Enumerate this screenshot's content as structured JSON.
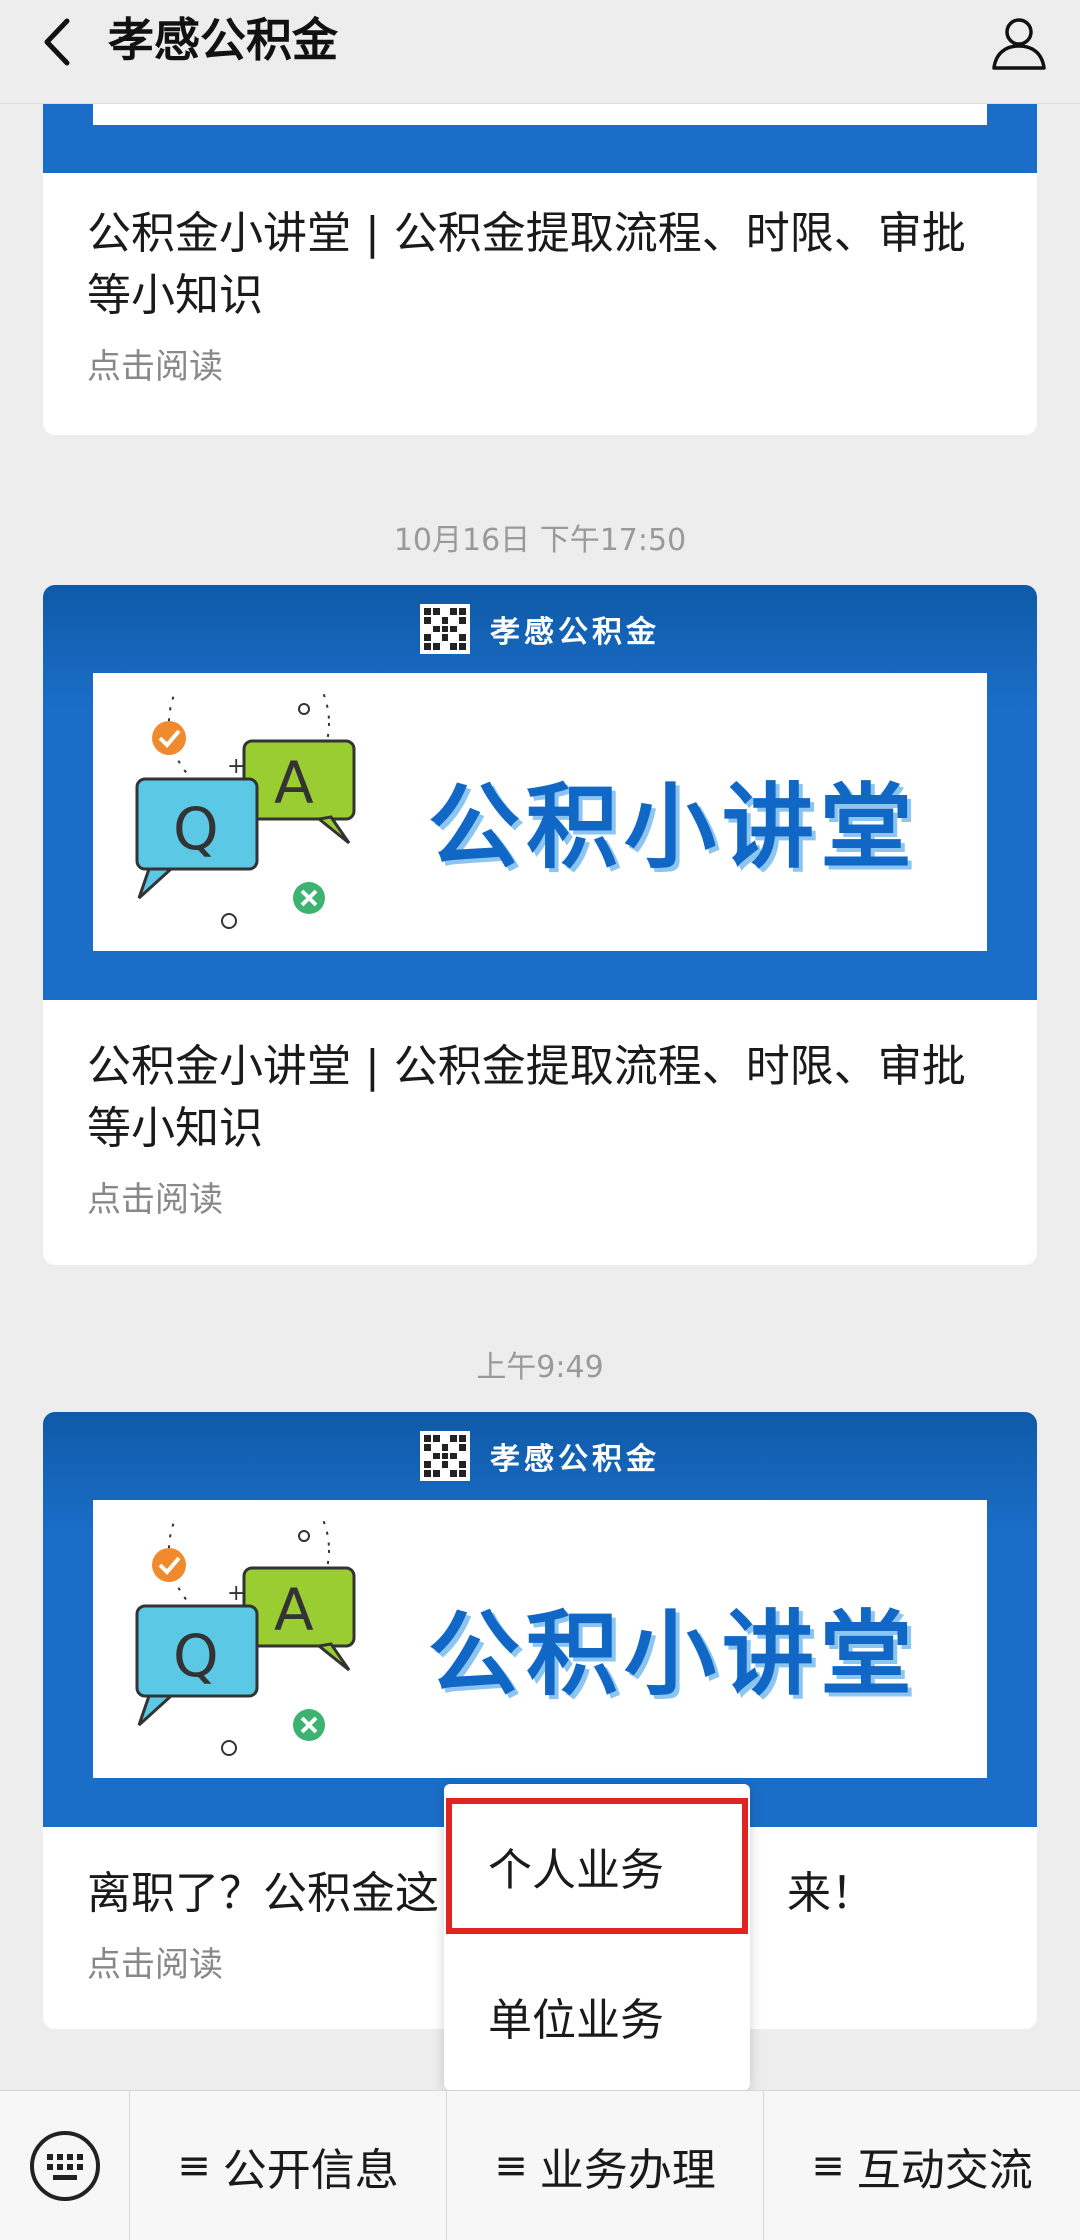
{
  "header": {
    "title": "孝感公积金",
    "back_icon": "chevron-left-icon",
    "profile_icon": "user-icon"
  },
  "articles": [
    {
      "title": "公积金小讲堂 | 公积金提取流程、时限、审批等小知识",
      "read_more": "点击阅读"
    },
    {
      "timestamp": "10月16日 下午17:50",
      "cover_brand": "孝感公积金",
      "cover_title": "公积小讲堂",
      "title": "公积金小讲堂 | 公积金提取流程、时限、审批等小知识",
      "read_more": "点击阅读"
    },
    {
      "timestamp": "上午9:49",
      "cover_brand": "孝感公积金",
      "cover_title": "公积小讲堂",
      "title_left": "离职了？公积金这",
      "title_right": "来！",
      "read_more": "点击阅读"
    }
  ],
  "popup_menu": {
    "items": [
      "个人业务",
      "单位业务"
    ],
    "highlighted_index": 0
  },
  "menu_bar": {
    "keyboard_icon": "keyboard-icon",
    "items": [
      "公开信息",
      "业务办理",
      "互动交流"
    ],
    "menu_glyph": "≡"
  },
  "colors": {
    "cover_blue": "#1a6ec8",
    "highlight_red": "#e02424",
    "title_blue": "#1167c6"
  }
}
